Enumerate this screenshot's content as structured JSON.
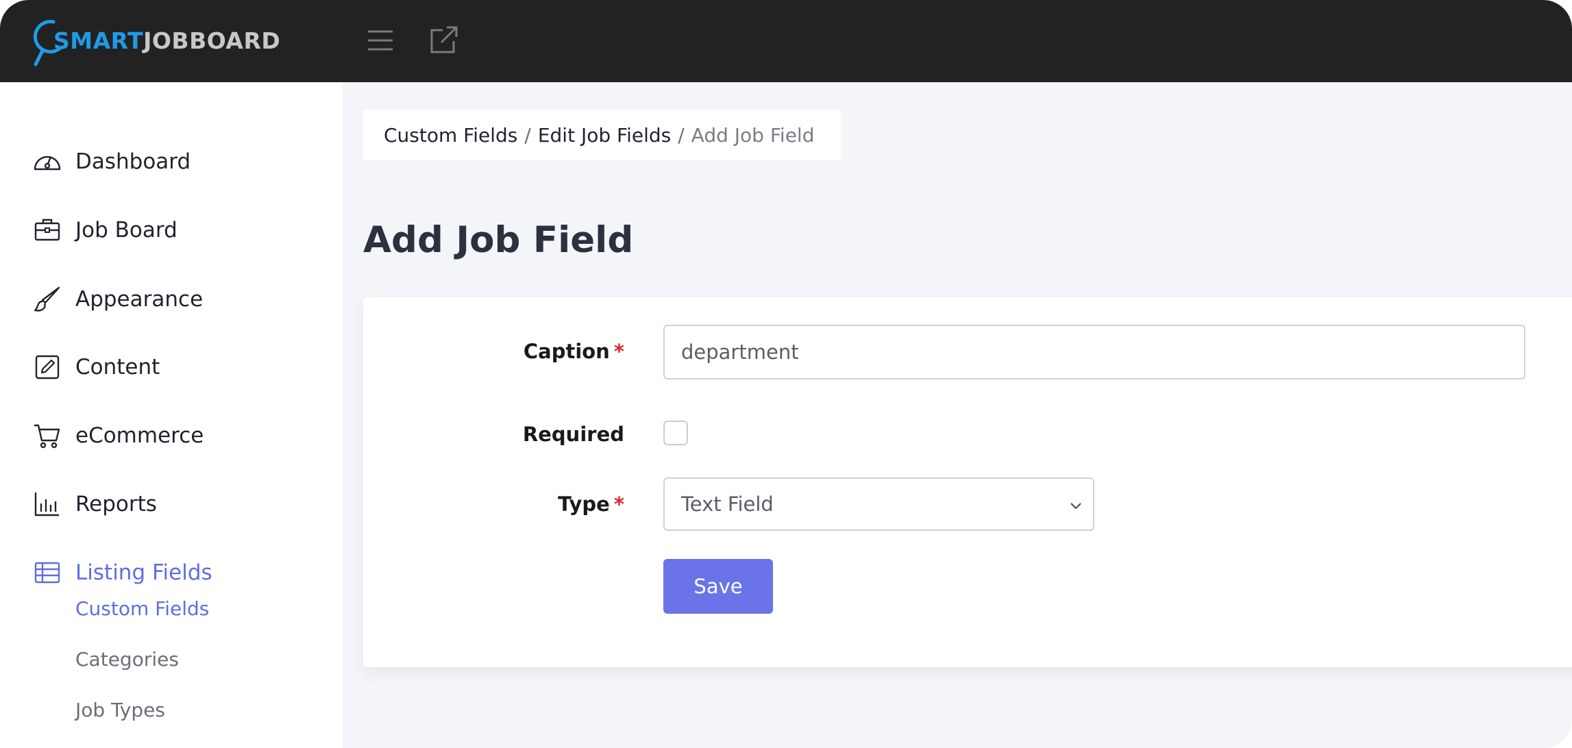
{
  "brand": {
    "part1": "SMART",
    "part2": "JOBBOARD",
    "colors": {
      "primary": "#1e9be8",
      "secondary": "#c8c8c8"
    }
  },
  "topbar": {
    "icons": [
      "menu-icon",
      "external-link-icon"
    ]
  },
  "sidebar": {
    "items": [
      {
        "label": "Dashboard",
        "icon": "dashboard-gauge-icon"
      },
      {
        "label": "Job Board",
        "icon": "briefcase-icon"
      },
      {
        "label": "Appearance",
        "icon": "paintbrush-icon"
      },
      {
        "label": "Content",
        "icon": "edit-square-icon"
      },
      {
        "label": "eCommerce",
        "icon": "cart-icon"
      },
      {
        "label": "Reports",
        "icon": "bar-chart-icon"
      },
      {
        "label": "Listing Fields",
        "icon": "table-icon",
        "active": true
      }
    ],
    "subitems": [
      {
        "label": "Custom Fields",
        "active": true
      },
      {
        "label": "Categories"
      },
      {
        "label": "Job Types"
      }
    ],
    "accent_color": "#5f6ee0"
  },
  "breadcrumb": {
    "items": [
      "Custom Fields",
      "Edit Job Fields"
    ],
    "current": "Add Job Field",
    "separator": "/"
  },
  "page": {
    "title": "Add Job Field"
  },
  "form": {
    "caption": {
      "label": "Caption",
      "required_mark": "*",
      "value": "department"
    },
    "required": {
      "label": "Required",
      "checked": false
    },
    "type": {
      "label": "Type",
      "required_mark": "*",
      "selected": "Text Field"
    },
    "save_label": "Save",
    "save_color": "#6a74e8"
  }
}
